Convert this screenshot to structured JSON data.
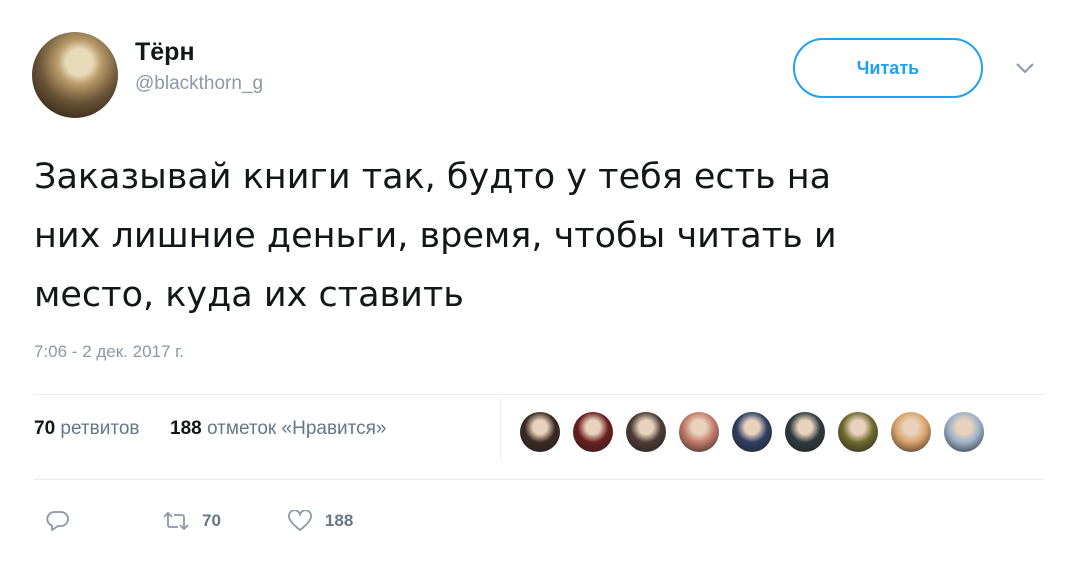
{
  "author": {
    "name": "Тёрн",
    "handle": "@blackthorn_g"
  },
  "follow_button": {
    "label": "Читать"
  },
  "tweet": {
    "lines": [
      "Заказывай книги так, будто у тебя есть на",
      "них лишние деньги, время, чтобы читать и",
      "место, куда их ставить"
    ],
    "timestamp": "7:06 - 2 дек. 2017 г."
  },
  "stats": {
    "retweets_count": "70",
    "retweets_label": "ретвитов",
    "likes_count": "188",
    "likes_label": "отметок «Нравится»"
  },
  "likers_colors": [
    "#3b2a24",
    "#6b1f1f",
    "#4a3b36",
    "#c27a6a",
    "#2e3e63",
    "#2f3a3f",
    "#6e6a2e",
    "#d9a36a",
    "#9cb3c9"
  ],
  "actions": {
    "reply_icon": "reply-icon",
    "retweet_icon": "retweet-icon",
    "retweet_count": "70",
    "like_icon": "heart-icon",
    "like_count": "188"
  },
  "colors": {
    "accent": "#1da1f2",
    "muted": "#8b98a5"
  }
}
